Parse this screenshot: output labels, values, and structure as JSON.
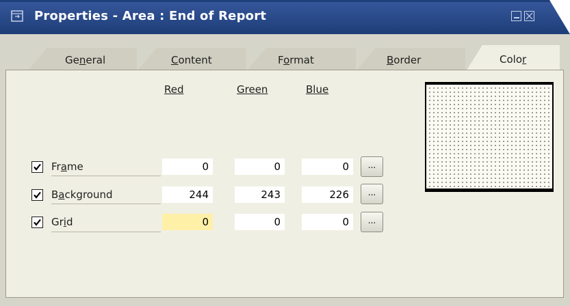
{
  "window": {
    "title": "Properties - Area : End of Report",
    "title_color": "#1f3f7a"
  },
  "tabs": [
    {
      "pre": "Ge",
      "ul": "n",
      "post": "eral"
    },
    {
      "pre": "",
      "ul": "C",
      "post": "ontent"
    },
    {
      "pre": "F",
      "ul": "o",
      "post": "rmat"
    },
    {
      "pre": "",
      "ul": "B",
      "post": "order"
    },
    {
      "pre": "Colo",
      "ul": "r",
      "post": ""
    }
  ],
  "active_tab": "Color",
  "columns": {
    "red": "Red",
    "green": "Green",
    "blue": "Blue"
  },
  "rows": [
    {
      "label_pre": "Fr",
      "label_ul": "a",
      "label_post": "me",
      "checked": true,
      "red": "0",
      "green": "0",
      "blue": "0",
      "button": "..."
    },
    {
      "label_pre": "B",
      "label_ul": "a",
      "label_post": "ckground",
      "checked": true,
      "red": "244",
      "green": "243",
      "blue": "226",
      "button": "..."
    },
    {
      "label_pre": "Gr",
      "label_ul": "i",
      "label_post": "d",
      "checked": true,
      "red": "0",
      "green": "0",
      "blue": "0",
      "button": "...",
      "red_highlight_color": "#fff0a8"
    }
  ],
  "preview": {
    "background_color": "#f4f3e2",
    "frame_color": "#000000",
    "grid_color": "#000000"
  }
}
